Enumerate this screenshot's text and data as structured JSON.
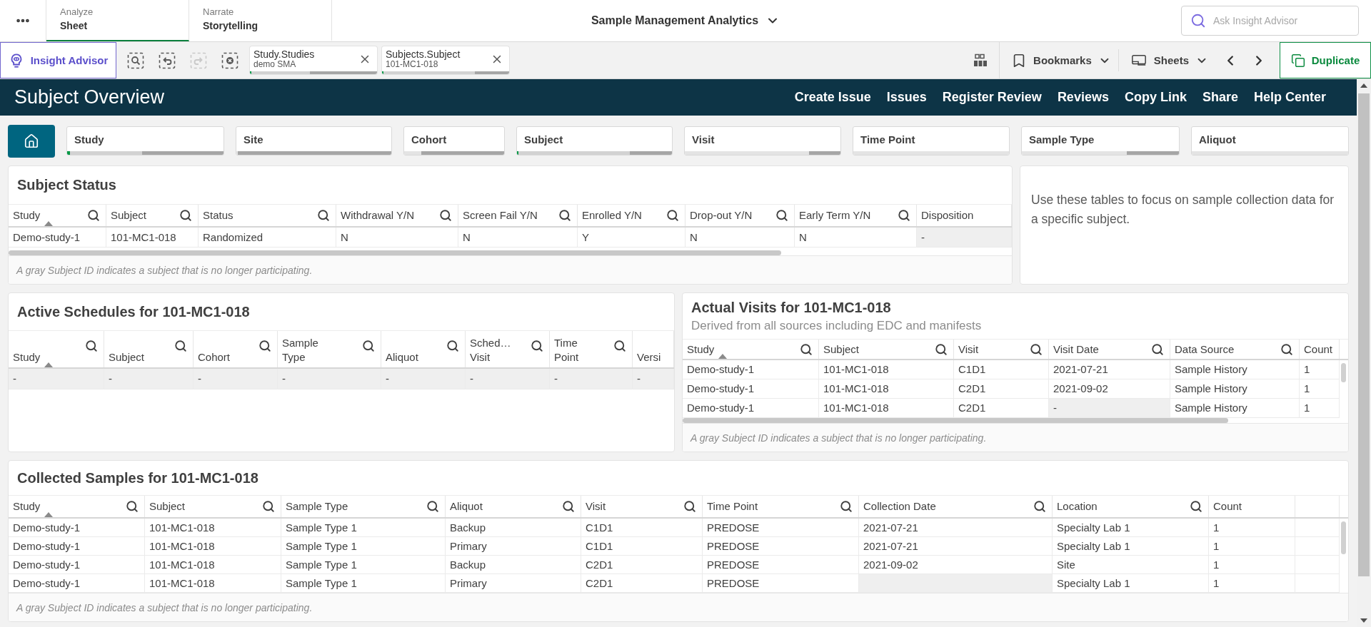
{
  "top_bar": {
    "tabs": [
      {
        "mode": "Analyze",
        "label": "Sheet",
        "selected": true
      },
      {
        "mode": "Narrate",
        "label": "Storytelling",
        "selected": false
      }
    ],
    "app_title": "Sample Management Analytics",
    "search": {
      "placeholder": "Ask Insight Advisor"
    }
  },
  "toolbar": {
    "insight_advisor": "Insight Advisor",
    "selection_tools": [
      {
        "kind": "search",
        "disabled": false
      },
      {
        "kind": "back",
        "disabled": false
      },
      {
        "kind": "forward",
        "disabled": true
      },
      {
        "kind": "clear",
        "disabled": false
      }
    ],
    "selections": [
      {
        "field": "Study.Studies",
        "value": "demo SMA",
        "bar": [
          {
            "kind": "selected",
            "level": 0.01
          },
          {
            "kind": "alternative",
            "level": 0.46
          },
          {
            "kind": "excluded",
            "level": 0.53
          }
        ]
      },
      {
        "field": "Subjects.Subject",
        "value": "101-MC1-018",
        "bar": [
          {
            "kind": "selected",
            "level": 0.01
          },
          {
            "kind": "alternative",
            "level": 0.72
          },
          {
            "kind": "excluded",
            "level": 0.27
          }
        ]
      }
    ],
    "bookmarks": "Bookmarks",
    "sheets": "Sheets",
    "duplicate": "Duplicate"
  },
  "sheet_header": {
    "title": "Subject Overview",
    "links": [
      "Create Issue",
      "Issues",
      "Register Review",
      "Reviews",
      "Copy Link",
      "Share",
      "Help Center"
    ]
  },
  "filters": [
    {
      "label": "Study",
      "bar": [
        {
          "kind": "selected",
          "level": 0.02
        },
        {
          "kind": "alternative",
          "level": 0.46
        },
        {
          "kind": "excluded",
          "level": 0.52
        }
      ]
    },
    {
      "label": "Site",
      "bar": [
        {
          "kind": "possible",
          "level": 0.01
        },
        {
          "kind": "excluded",
          "level": 0.99
        }
      ]
    },
    {
      "label": "Cohort",
      "bar": [
        {
          "kind": "possible",
          "level": 0.17
        },
        {
          "kind": "excluded",
          "level": 0.83
        }
      ]
    },
    {
      "label": "Subject",
      "bar": [
        {
          "kind": "selected",
          "level": 0.01
        },
        {
          "kind": "alternative",
          "level": 0.72
        },
        {
          "kind": "excluded",
          "level": 0.27
        }
      ]
    },
    {
      "label": "Visit",
      "bar": [
        {
          "kind": "possible",
          "level": 0.8
        },
        {
          "kind": "excluded",
          "level": 0.2
        }
      ]
    },
    {
      "label": "Time Point",
      "bar": [
        {
          "kind": "possible",
          "level": 1
        }
      ]
    },
    {
      "label": "Sample Type",
      "bar": [
        {
          "kind": "possible",
          "level": 0.67
        },
        {
          "kind": "excluded",
          "level": 0.33
        }
      ]
    },
    {
      "label": "Aliquot",
      "bar": [
        {
          "kind": "possible",
          "level": 1
        }
      ]
    }
  ],
  "subject_status": {
    "title": "Subject Status",
    "columns": [
      {
        "label": "Study",
        "sorted": true,
        "searchable": true
      },
      {
        "label": "Subject",
        "sorted": false,
        "searchable": true
      },
      {
        "label": "Status",
        "sorted": false,
        "searchable": true
      },
      {
        "label": "Withdrawal Y/N",
        "sorted": false,
        "searchable": true
      },
      {
        "label": "Screen Fail Y/N",
        "sorted": false,
        "searchable": true
      },
      {
        "label": "Enrolled Y/N",
        "sorted": false,
        "searchable": true
      },
      {
        "label": "Drop-out Y/N",
        "sorted": false,
        "searchable": true
      },
      {
        "label": "Early Term Y/N",
        "sorted": false,
        "searchable": true
      },
      {
        "label": "Disposition",
        "sorted": false,
        "searchable": false
      }
    ],
    "rows": [
      {
        "cells": [
          {
            "text": "Demo-study-1",
            "missing": false
          },
          {
            "text": "101-MC1-018",
            "missing": false
          },
          {
            "text": "Randomized",
            "missing": false
          },
          {
            "text": "N",
            "missing": false
          },
          {
            "text": "N",
            "missing": false
          },
          {
            "text": "Y",
            "missing": false
          },
          {
            "text": "N",
            "missing": false
          },
          {
            "text": "N",
            "missing": false
          },
          {
            "text": "-",
            "missing": true
          }
        ]
      }
    ],
    "footnote": "A gray Subject ID indicates a subject that is no longer participating."
  },
  "info": {
    "text": "Use these tables to focus on sample collection data for a specific subject."
  },
  "active_schedules": {
    "title": "Active Schedules for 101-MC1-018",
    "columns": [
      {
        "label": "Study",
        "sorted": true,
        "searchable": true
      },
      {
        "label": "Subject",
        "sorted": false,
        "searchable": true
      },
      {
        "label": "Cohort",
        "sorted": false,
        "searchable": true
      },
      {
        "label": "Sample Type",
        "sorted": false,
        "searchable": true
      },
      {
        "label": "Aliquot",
        "sorted": false,
        "searchable": true
      },
      {
        "label": "Sched… Visit",
        "sorted": false,
        "searchable": true
      },
      {
        "label": "Time Point",
        "sorted": false,
        "searchable": true
      },
      {
        "label": "Versi",
        "sorted": false,
        "searchable": false
      }
    ],
    "rows": [
      {
        "cells": [
          {
            "text": "-",
            "missing": true
          },
          {
            "text": "-",
            "missing": true
          },
          {
            "text": "-",
            "missing": true
          },
          {
            "text": "-",
            "missing": true
          },
          {
            "text": "-",
            "missing": true
          },
          {
            "text": "-",
            "missing": true
          },
          {
            "text": "-",
            "missing": true
          },
          {
            "text": "-",
            "missing": true
          }
        ]
      }
    ]
  },
  "actual_visits": {
    "title": "Actual Visits for 101-MC1-018",
    "subtitle": "Derived from all sources including EDC and manifests",
    "columns": [
      {
        "label": "Study",
        "sorted": true,
        "searchable": true
      },
      {
        "label": "Subject",
        "sorted": false,
        "searchable": true
      },
      {
        "label": "Visit",
        "sorted": false,
        "searchable": true
      },
      {
        "label": "Visit Date",
        "sorted": false,
        "searchable": true
      },
      {
        "label": "Data Source",
        "sorted": false,
        "searchable": true
      },
      {
        "label": "Count",
        "sorted": false,
        "searchable": false
      }
    ],
    "rows": [
      {
        "cells": [
          {
            "text": "Demo-study-1",
            "missing": false
          },
          {
            "text": "101-MC1-018",
            "missing": false
          },
          {
            "text": "C1D1",
            "missing": false
          },
          {
            "text": "2021-07-21",
            "missing": false
          },
          {
            "text": "Sample History",
            "missing": false
          },
          {
            "text": "1",
            "missing": false
          }
        ]
      },
      {
        "cells": [
          {
            "text": "Demo-study-1",
            "missing": false
          },
          {
            "text": "101-MC1-018",
            "missing": false
          },
          {
            "text": "C2D1",
            "missing": false
          },
          {
            "text": "2021-09-02",
            "missing": false
          },
          {
            "text": "Sample History",
            "missing": false
          },
          {
            "text": "1",
            "missing": false
          }
        ]
      },
      {
        "cells": [
          {
            "text": "Demo-study-1",
            "missing": false
          },
          {
            "text": "101-MC1-018",
            "missing": false
          },
          {
            "text": "C2D1",
            "missing": false
          },
          {
            "text": "-",
            "missing": true
          },
          {
            "text": "Sample History",
            "missing": false
          },
          {
            "text": "1",
            "missing": false
          }
        ]
      }
    ],
    "footnote": "A gray Subject ID indicates a subject that is no longer participating."
  },
  "collected_samples": {
    "title": "Collected Samples for 101-MC1-018",
    "columns": [
      {
        "label": "Study",
        "sorted": true,
        "searchable": true
      },
      {
        "label": "Subject",
        "sorted": false,
        "searchable": true
      },
      {
        "label": "Sample Type",
        "sorted": false,
        "searchable": true
      },
      {
        "label": "Aliquot",
        "sorted": false,
        "searchable": true
      },
      {
        "label": "Visit",
        "sorted": false,
        "searchable": true
      },
      {
        "label": "Time Point",
        "sorted": false,
        "searchable": true
      },
      {
        "label": "Collection Date",
        "sorted": false,
        "searchable": true
      },
      {
        "label": "Location",
        "sorted": false,
        "searchable": true
      },
      {
        "label": "Count",
        "sorted": false,
        "searchable": false
      }
    ],
    "rows": [
      {
        "cells": [
          {
            "text": "Demo-study-1",
            "missing": false
          },
          {
            "text": "101-MC1-018",
            "missing": false
          },
          {
            "text": "Sample Type 1",
            "missing": false
          },
          {
            "text": "Backup",
            "missing": false
          },
          {
            "text": "C1D1",
            "missing": false
          },
          {
            "text": "PREDOSE",
            "missing": false
          },
          {
            "text": "2021-07-21",
            "missing": false
          },
          {
            "text": "Specialty Lab 1",
            "missing": false
          },
          {
            "text": "1",
            "missing": false
          }
        ]
      },
      {
        "cells": [
          {
            "text": "Demo-study-1",
            "missing": false
          },
          {
            "text": "101-MC1-018",
            "missing": false
          },
          {
            "text": "Sample Type 1",
            "missing": false
          },
          {
            "text": "Primary",
            "missing": false
          },
          {
            "text": "C1D1",
            "missing": false
          },
          {
            "text": "PREDOSE",
            "missing": false
          },
          {
            "text": "2021-07-21",
            "missing": false
          },
          {
            "text": "Specialty Lab 1",
            "missing": false
          },
          {
            "text": "1",
            "missing": false
          }
        ]
      },
      {
        "cells": [
          {
            "text": "Demo-study-1",
            "missing": false
          },
          {
            "text": "101-MC1-018",
            "missing": false
          },
          {
            "text": "Sample Type 1",
            "missing": false
          },
          {
            "text": "Backup",
            "missing": false
          },
          {
            "text": "C2D1",
            "missing": false
          },
          {
            "text": "PREDOSE",
            "missing": false
          },
          {
            "text": "2021-09-02",
            "missing": false
          },
          {
            "text": "Site",
            "missing": false
          },
          {
            "text": "1",
            "missing": false
          }
        ]
      },
      {
        "cells": [
          {
            "text": "Demo-study-1",
            "missing": false
          },
          {
            "text": "101-MC1-018",
            "missing": false
          },
          {
            "text": "Sample Type 1",
            "missing": false
          },
          {
            "text": "Primary",
            "missing": false
          },
          {
            "text": "C2D1",
            "missing": false
          },
          {
            "text": "PREDOSE",
            "missing": false
          },
          {
            "missing": true
          },
          {
            "text": "Specialty Lab 1",
            "missing": false
          },
          {
            "text": "1",
            "missing": false
          }
        ]
      }
    ],
    "footnote": "A gray Subject ID indicates a subject that is no longer participating."
  }
}
